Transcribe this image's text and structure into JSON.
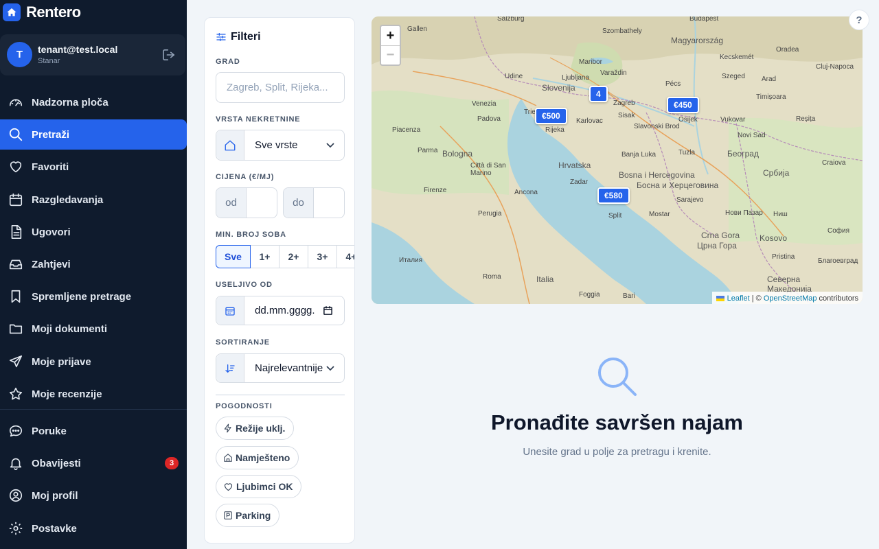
{
  "brand": {
    "name": "Rentero"
  },
  "user": {
    "initial": "T",
    "email": "tenant@test.local",
    "role": "Stanar"
  },
  "nav": {
    "items": [
      {
        "label": "Nadzorna ploča",
        "icon": "dashboard-icon"
      },
      {
        "label": "Pretraži",
        "icon": "search-icon",
        "active": true
      },
      {
        "label": "Favoriti",
        "icon": "heart-icon"
      },
      {
        "label": "Razgledavanja",
        "icon": "calendar-icon"
      },
      {
        "label": "Ugovori",
        "icon": "document-icon"
      },
      {
        "label": "Zahtjevi",
        "icon": "inbox-icon"
      },
      {
        "label": "Spremljene pretrage",
        "icon": "bookmark-icon"
      },
      {
        "label": "Moji dokumenti",
        "icon": "folder-icon"
      },
      {
        "label": "Moje prijave",
        "icon": "send-icon"
      },
      {
        "label": "Moje recenzije",
        "icon": "star-icon"
      }
    ],
    "secondary": [
      {
        "label": "Poruke",
        "icon": "chat-icon"
      },
      {
        "label": "Obavijesti",
        "icon": "bell-icon",
        "badge": "3"
      },
      {
        "label": "Moj profil",
        "icon": "user-icon"
      },
      {
        "label": "Postavke",
        "icon": "gear-icon"
      }
    ]
  },
  "filters": {
    "title": "Filteri",
    "city_label": "GRAD",
    "city_placeholder": "Zagreb, Split, Rijeka...",
    "type_label": "VRSTA NEKRETNINE",
    "type_value": "Sve vrste",
    "price_label": "CIJENA (€/MJ)",
    "price_from": "od",
    "price_to": "do",
    "rooms_label": "MIN. BROJ SOBA",
    "rooms_options": [
      "Sve",
      "1+",
      "2+",
      "3+",
      "4+"
    ],
    "movein_label": "USELJIVO OD",
    "movein_placeholder": "dd.mm.gggg.",
    "sort_label": "SORTIRANJE",
    "sort_value": "Najrelevantnije",
    "amenities_label": "POGODNOSTI",
    "amenities": [
      "Režije uklj.",
      "Namješteno",
      "Ljubimci OK",
      "Parking"
    ]
  },
  "map": {
    "zoom_in": "+",
    "zoom_out": "−",
    "markers": [
      "4",
      "€450",
      "€500",
      "€580"
    ],
    "attribution_leaflet": "Leaflet",
    "attribution_sep": " | © ",
    "attribution_osm": "OpenStreetMap",
    "attribution_tail": " contributors",
    "labels": [
      "Salzburg",
      "Gallen",
      "Szombathely",
      "Budapest",
      "Magyarország",
      "Kecskemét",
      "Oradea",
      "Cluj-Napoca",
      "Maribor",
      "Varaždin",
      "Pécs",
      "Szeged",
      "Arad",
      "Udine",
      "Ljubljana",
      "Slovenija",
      "Zagreb",
      "Timișoara",
      "Padova",
      "Trieste",
      "Karlovac",
      "Sisak",
      "Osijek",
      "Venezia",
      "Rijeka",
      "Slavonski Brod",
      "Vukovar",
      "Novi Sad",
      "Reșița",
      "Piacenza",
      "Parma",
      "Bologna",
      "Hrvatska",
      "Banja Luka",
      "Tuzla",
      "Београд",
      "Craiova",
      "Città di San Marino",
      "Bosna i Hercegovina",
      "Босна и Херцеговина",
      "Србија",
      "Firenze",
      "Ancona",
      "Zadar",
      "Split",
      "Sarajevo",
      "Perugia",
      "Mostar",
      "Нови Пазар",
      "Ниш",
      "Италия",
      "Crna Gora",
      "Црна Гора",
      "Kosovo",
      "Pristina",
      "София",
      "Roma",
      "Italia",
      "Foggia",
      "Bari",
      "Северна Македонија",
      "Благоевград"
    ]
  },
  "help": {
    "label": "?"
  },
  "empty": {
    "title": "Pronađite savršen najam",
    "subtitle": "Unesite grad u polje za pretragu i krenite."
  }
}
